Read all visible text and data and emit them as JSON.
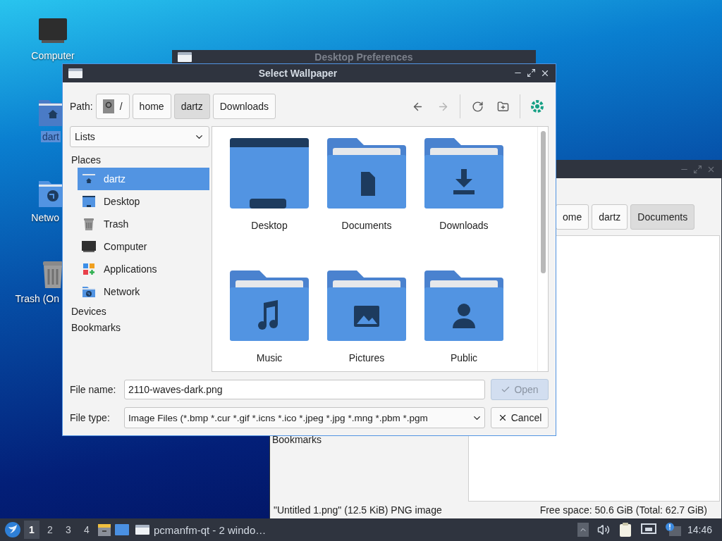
{
  "desktop_icons": [
    {
      "label": "Computer",
      "kind": "computer",
      "selected": false
    },
    {
      "label": "dart",
      "kind": "home",
      "selected": true
    },
    {
      "label": "Netwo",
      "kind": "network",
      "selected": false
    },
    {
      "label": "Trash (On",
      "kind": "trash",
      "selected": false
    }
  ],
  "preferences_window": {
    "title": "Desktop Preferences"
  },
  "file_manager": {
    "path": [
      {
        "label": "ome",
        "selected": false
      },
      {
        "label": "dartz",
        "selected": false
      },
      {
        "label": "Documents",
        "selected": true
      }
    ],
    "sidebar": [
      "Bookmarks"
    ],
    "status_left": "\"Untitled 1.png\" (12.5 KiB) PNG image",
    "status_right": "Free space: 50.6 GiB (Total: 62.7 GiB)"
  },
  "dialog": {
    "title": "Select Wallpaper",
    "path_label": "Path:",
    "path": [
      {
        "label": "/",
        "kind": "root",
        "selected": false
      },
      {
        "label": "home",
        "kind": "dir",
        "selected": false
      },
      {
        "label": "dartz",
        "kind": "dir",
        "selected": true
      },
      {
        "label": "Downloads",
        "kind": "dir",
        "selected": false
      }
    ],
    "nav": [
      {
        "kind": "back",
        "disabled": false
      },
      {
        "kind": "forward",
        "disabled": true
      },
      {
        "kind": "reload",
        "disabled": false
      },
      {
        "kind": "new-folder",
        "disabled": false
      }
    ],
    "view_mode": "Lists",
    "places_header": "Places",
    "places": [
      {
        "label": "dartz",
        "kind": "home",
        "selected": true
      },
      {
        "label": "Desktop",
        "kind": "desktop",
        "selected": false
      },
      {
        "label": "Trash",
        "kind": "trash",
        "selected": false
      },
      {
        "label": "Computer",
        "kind": "computer",
        "selected": false
      },
      {
        "label": "Applications",
        "kind": "apps",
        "selected": false
      },
      {
        "label": "Network",
        "kind": "network",
        "selected": false
      }
    ],
    "sections": [
      "Devices",
      "Bookmarks"
    ],
    "files": [
      {
        "name": "Desktop",
        "kind": "desktop"
      },
      {
        "name": "Documents",
        "kind": "document"
      },
      {
        "name": "Downloads",
        "kind": "download"
      },
      {
        "name": "Music",
        "kind": "music"
      },
      {
        "name": "Pictures",
        "kind": "picture"
      },
      {
        "name": "Public",
        "kind": "public"
      }
    ],
    "file_name_label": "File name:",
    "file_name": "2110-waves-dark.png",
    "file_type_label": "File type:",
    "file_type": "Image Files (*.bmp *.cur *.gif *.icns *.ico *.jpeg *.jpg *.mng *.pbm *.pgm",
    "open_button": {
      "label": "Open",
      "disabled": true
    },
    "cancel_button": "Cancel"
  },
  "taskbar": {
    "workspaces": [
      {
        "label": "1",
        "selected": true
      },
      {
        "label": "2",
        "selected": false
      },
      {
        "label": "3",
        "selected": false
      },
      {
        "label": "4",
        "selected": false
      }
    ],
    "task": "pcmanfm-qt - 2 windo…",
    "clock": "14:46"
  }
}
